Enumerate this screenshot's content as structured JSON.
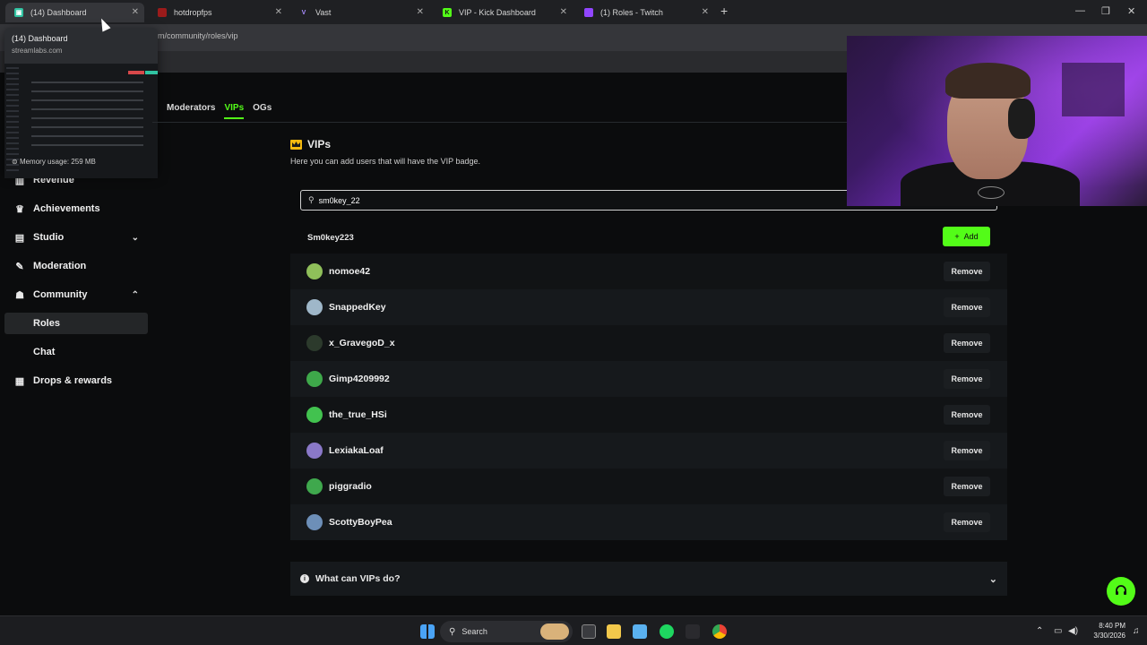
{
  "browser": {
    "tabs": [
      {
        "label": "(14) Dashboard",
        "favicon_color": "#31c3a2",
        "active": true
      },
      {
        "label": "hotdropfps",
        "favicon_color": "#9b1b1b",
        "active": false
      },
      {
        "label": "Vast",
        "favicon_color": "#7c4dff",
        "active": false
      },
      {
        "label": "VIP - Kick Dashboard",
        "favicon_color": "#53fc18",
        "active": false
      },
      {
        "label": "(1) Roles - Twitch",
        "favicon_color": "#9146ff",
        "active": false
      }
    ],
    "address_partial": "m/community/roles/vip",
    "tab_preview": {
      "title": "(14) Dashboard",
      "url": "streamlabs.com",
      "memory": "Memory usage: 259 MB"
    }
  },
  "sidebar": {
    "items": [
      {
        "label": "Revenue",
        "icon": "revenue-icon"
      },
      {
        "label": "Achievements",
        "icon": "trophy-icon"
      },
      {
        "label": "Studio",
        "icon": "studio-icon",
        "expandable": true
      },
      {
        "label": "Moderation",
        "icon": "wrench-icon"
      },
      {
        "label": "Community",
        "icon": "community-icon",
        "expandable": true,
        "expanded": true
      },
      {
        "label": "Roles",
        "sub": true,
        "selected": true
      },
      {
        "label": "Chat",
        "sub": true
      },
      {
        "label": "Drops & rewards",
        "icon": "gift-icon"
      }
    ]
  },
  "main": {
    "subtabs": [
      {
        "label": "Moderators",
        "active": false
      },
      {
        "label": "VIPs",
        "active": true
      },
      {
        "label": "OGs",
        "active": false
      }
    ],
    "title": "VIPs",
    "description": "Here you can add users that will have the VIP badge.",
    "search_value": "sm0key_22",
    "search_result": "Sm0key223",
    "add_label": "Add",
    "remove_label": "Remove",
    "vips": [
      {
        "name": "nomoe42",
        "avatar_color": "#8fbf5a"
      },
      {
        "name": "SnappedKey",
        "avatar_color": "#9fb7c9"
      },
      {
        "name": "x_GravegoD_x",
        "avatar_color": "#2c3a2c"
      },
      {
        "name": "Gimp4209992",
        "avatar_color": "#3ea84a"
      },
      {
        "name": "the_true_HSi",
        "avatar_color": "#42c24f"
      },
      {
        "name": "LexiakaLoaf",
        "avatar_color": "#8a78c8"
      },
      {
        "name": "piggradio",
        "avatar_color": "#3fa84d"
      },
      {
        "name": "ScottyBoyPea",
        "avatar_color": "#6d8fb8"
      }
    ],
    "faq": "What can VIPs do?"
  },
  "accent_color": "#53fc18",
  "taskbar": {
    "search_label": "Search",
    "time": "8:40 PM",
    "date": "3/30/2026"
  }
}
